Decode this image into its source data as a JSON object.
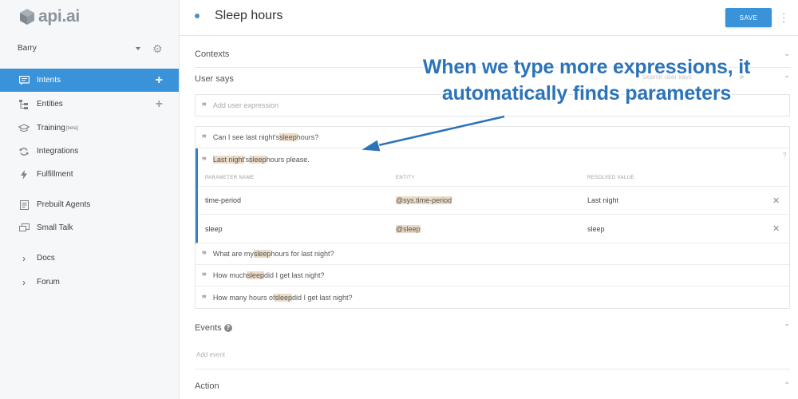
{
  "app": {
    "logo_text": "api.ai"
  },
  "sidebar": {
    "agent_name": "Barry",
    "items": [
      {
        "label": "Intents",
        "icon": "chat-bubble-icon",
        "has_add": true,
        "active": true
      },
      {
        "label": "Entities",
        "icon": "hierarchy-icon",
        "has_add": true,
        "active": false
      },
      {
        "label": "Training",
        "badge": "beta",
        "icon": "graduation-cap-icon",
        "active": false
      },
      {
        "label": "Integrations",
        "icon": "sync-icon",
        "active": false
      },
      {
        "label": "Fulfillment",
        "icon": "lightning-icon",
        "active": false
      },
      {
        "label": "Prebuilt Agents",
        "icon": "document-icon",
        "active": false
      },
      {
        "label": "Small Talk",
        "icon": "chat-icon",
        "active": false
      },
      {
        "label": "Docs",
        "icon": "chevron-right-icon",
        "active": false
      },
      {
        "label": "Forum",
        "icon": "chevron-right-icon",
        "active": false
      }
    ]
  },
  "header": {
    "title": "Sleep hours",
    "save_label": "SAVE"
  },
  "sections": {
    "contexts": "Contexts",
    "user_says": "User says",
    "search_placeholder": "Search user says",
    "add_expression_placeholder": "Add user expression",
    "events": "Events",
    "add_event_placeholder": "Add event",
    "action": "Action"
  },
  "expressions": [
    {
      "parts": [
        "Can I see last night's ",
        "sleep",
        " hours?"
      ]
    },
    {
      "parts": [
        "",
        "Last night",
        "'s ",
        "sleep",
        " hours please."
      ],
      "expanded": true
    },
    {
      "parts": [
        "What are my ",
        "sleep",
        " hours for last night?"
      ]
    },
    {
      "parts": [
        "How much ",
        "sleep",
        " did I get last night?"
      ]
    },
    {
      "parts": [
        "How many hours of ",
        "sleep",
        " did I get last night?"
      ]
    }
  ],
  "parameters": {
    "headers": [
      "PARAMETER NAME",
      "ENTITY",
      "RESOLVED VALUE"
    ],
    "rows": [
      {
        "name": "time-period",
        "entity": "@sys.time-period",
        "value": "Last night"
      },
      {
        "name": "sleep",
        "entity": "@sleep",
        "value": "sleep"
      }
    ]
  },
  "annotation": {
    "line1": "When we type more expressions, it",
    "line2": "automatically finds parameters"
  },
  "colors": {
    "accent": "#3a93d9",
    "highlight": "#ecdcc7",
    "annotation": "#2c73b8"
  }
}
